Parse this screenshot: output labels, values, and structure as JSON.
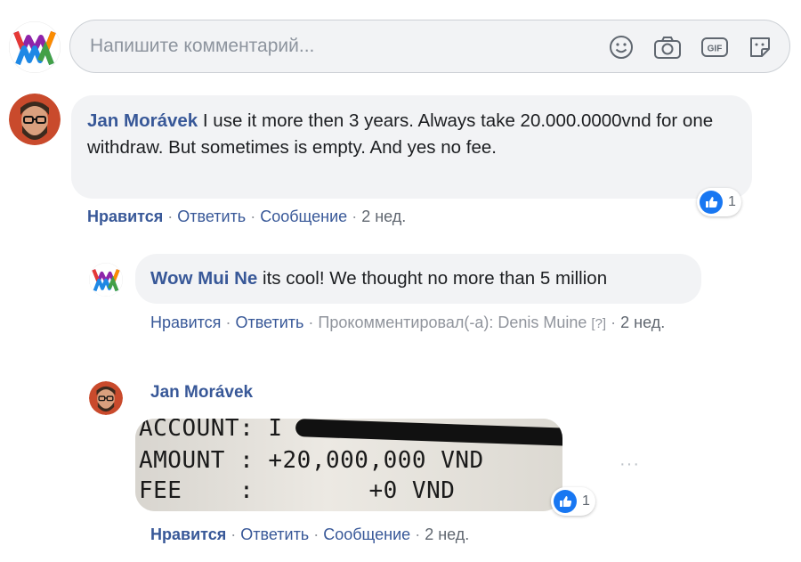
{
  "composer": {
    "placeholder": "Напишите комментарий...",
    "icons": [
      "emoji-icon",
      "camera-icon",
      "gif-icon",
      "sticker-icon"
    ]
  },
  "comments": [
    {
      "author": "Jan Morávek",
      "text": "I use it more then 3 years. Always take 20.000.0000vnd for one withdraw. But sometimes is empty. And yes no fee.",
      "reaction_count": "1",
      "actions": {
        "like": "Нравится",
        "reply": "Ответить",
        "message": "Сообщение",
        "time": "2 нед."
      }
    },
    {
      "author": "Wow Mui Ne",
      "text": "its cool! We thought no more than 5 million",
      "actions": {
        "like": "Нравится",
        "reply": "Ответить",
        "commented_by": "Прокомментировал(-а): Denis Muine",
        "help": "[?]",
        "time": "2 нед."
      }
    },
    {
      "author": "Jan Morávek",
      "photo_text": {
        "line1": "ACCOUNT: I",
        "line2": "AMOUNT : +20,000,000 VND",
        "line3": "FEE    :        +0 VND"
      },
      "reaction_count": "1",
      "more": "···",
      "actions": {
        "like": "Нравится",
        "reply": "Ответить",
        "message": "Сообщение",
        "time": "2 нед."
      }
    }
  ],
  "colors": {
    "link": "#385898",
    "muted": "#90949c",
    "bubble": "#f2f3f5",
    "like_blue": "#1877f2"
  }
}
